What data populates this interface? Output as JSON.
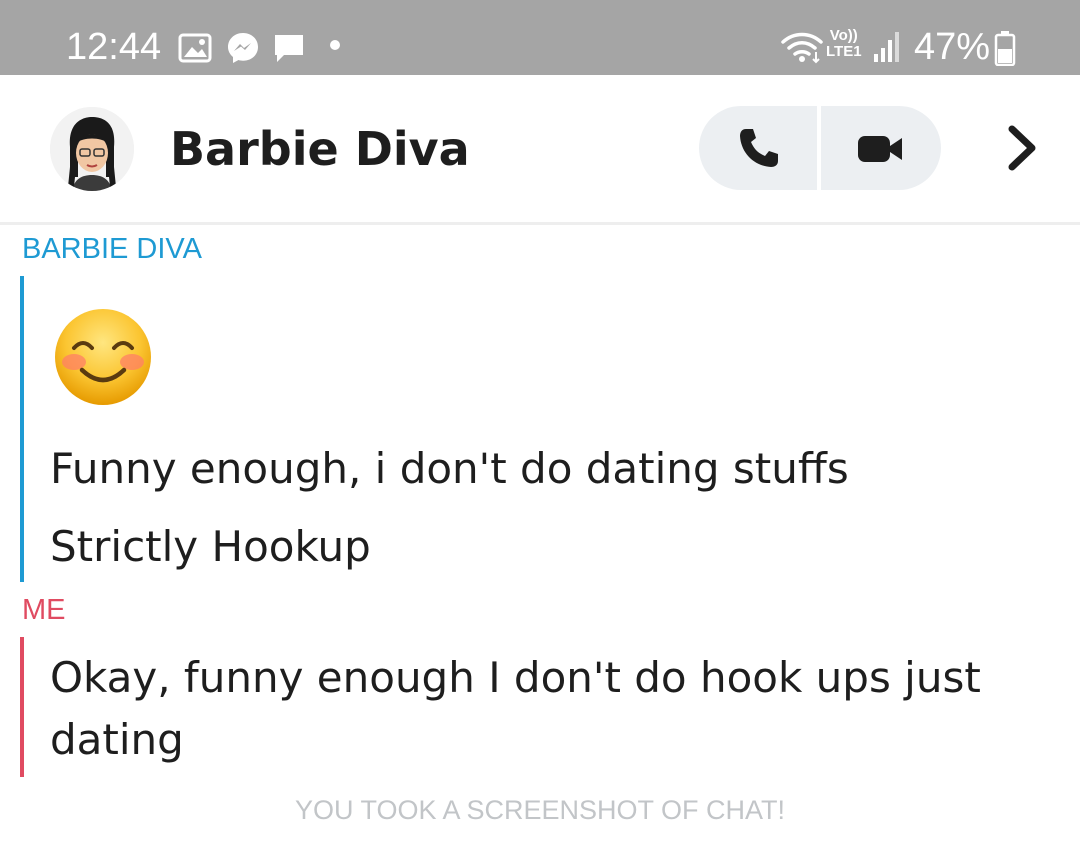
{
  "status_bar": {
    "time": "12:44",
    "lte_top": "Vo))",
    "lte_bottom": "LTE1",
    "battery": "47%",
    "notification_icons": [
      "gallery-icon",
      "messenger-icon",
      "chat-icon",
      "dot-icon"
    ]
  },
  "header": {
    "contact_name": "Barbie Diva",
    "call_buttons": [
      "phone-icon",
      "video-icon"
    ],
    "accent": "#eceff2"
  },
  "conversation": {
    "groups": [
      {
        "sender": "BARBIE DIVA",
        "color": "#1e9ad3",
        "emoji": "smiling-face-emoji",
        "lines": [
          "Funny enough, i don't do dating stuffs",
          "Strictly Hookup"
        ]
      },
      {
        "sender": "ME",
        "color": "#e04b61",
        "lines": [
          "Okay, funny enough I don't do hook ups just",
          "dating"
        ]
      }
    ]
  },
  "system_note": "YOU TOOK A SCREENSHOT OF CHAT!"
}
